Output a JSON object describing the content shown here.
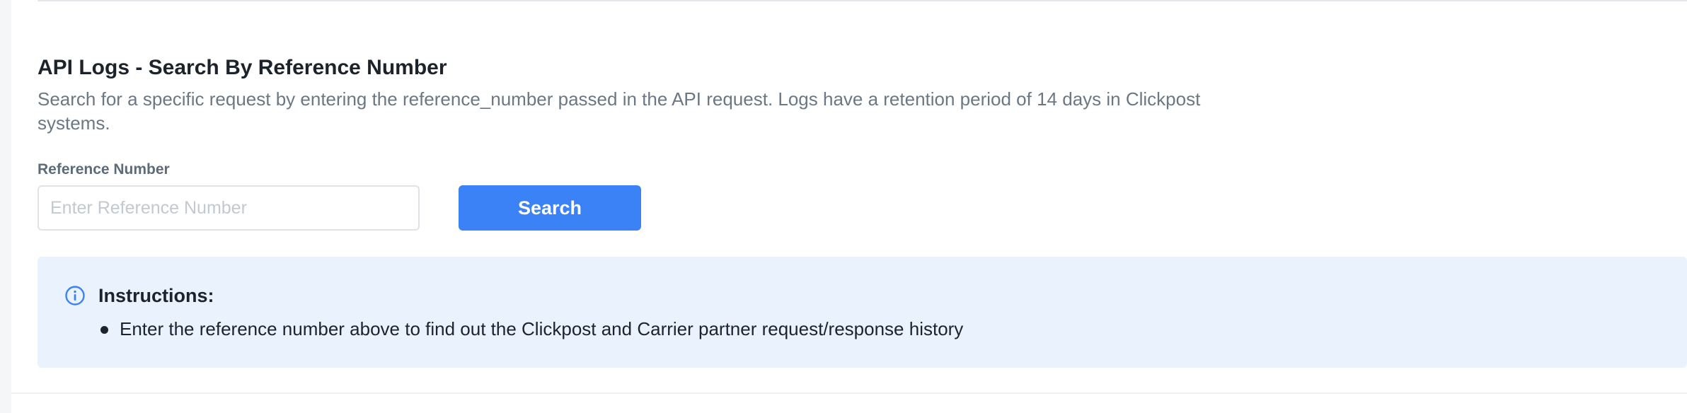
{
  "page": {
    "title": "API Logs - Search By Reference Number",
    "description": "Search for a specific request by entering the reference_number passed in the API request. Logs have a retention period of 14 days in Clickpost systems."
  },
  "form": {
    "field_label": "Reference Number",
    "input_value": "",
    "input_placeholder": "Enter Reference Number",
    "search_label": "Search"
  },
  "instructions": {
    "icon": "info-circle-icon",
    "heading": "Instructions:",
    "items": [
      "Enter the reference number above to find out the Clickpost and Carrier partner request/response history"
    ]
  },
  "colors": {
    "primary": "#3b82f6",
    "info_background": "#eaf2fd",
    "muted_text": "#6b7884"
  }
}
